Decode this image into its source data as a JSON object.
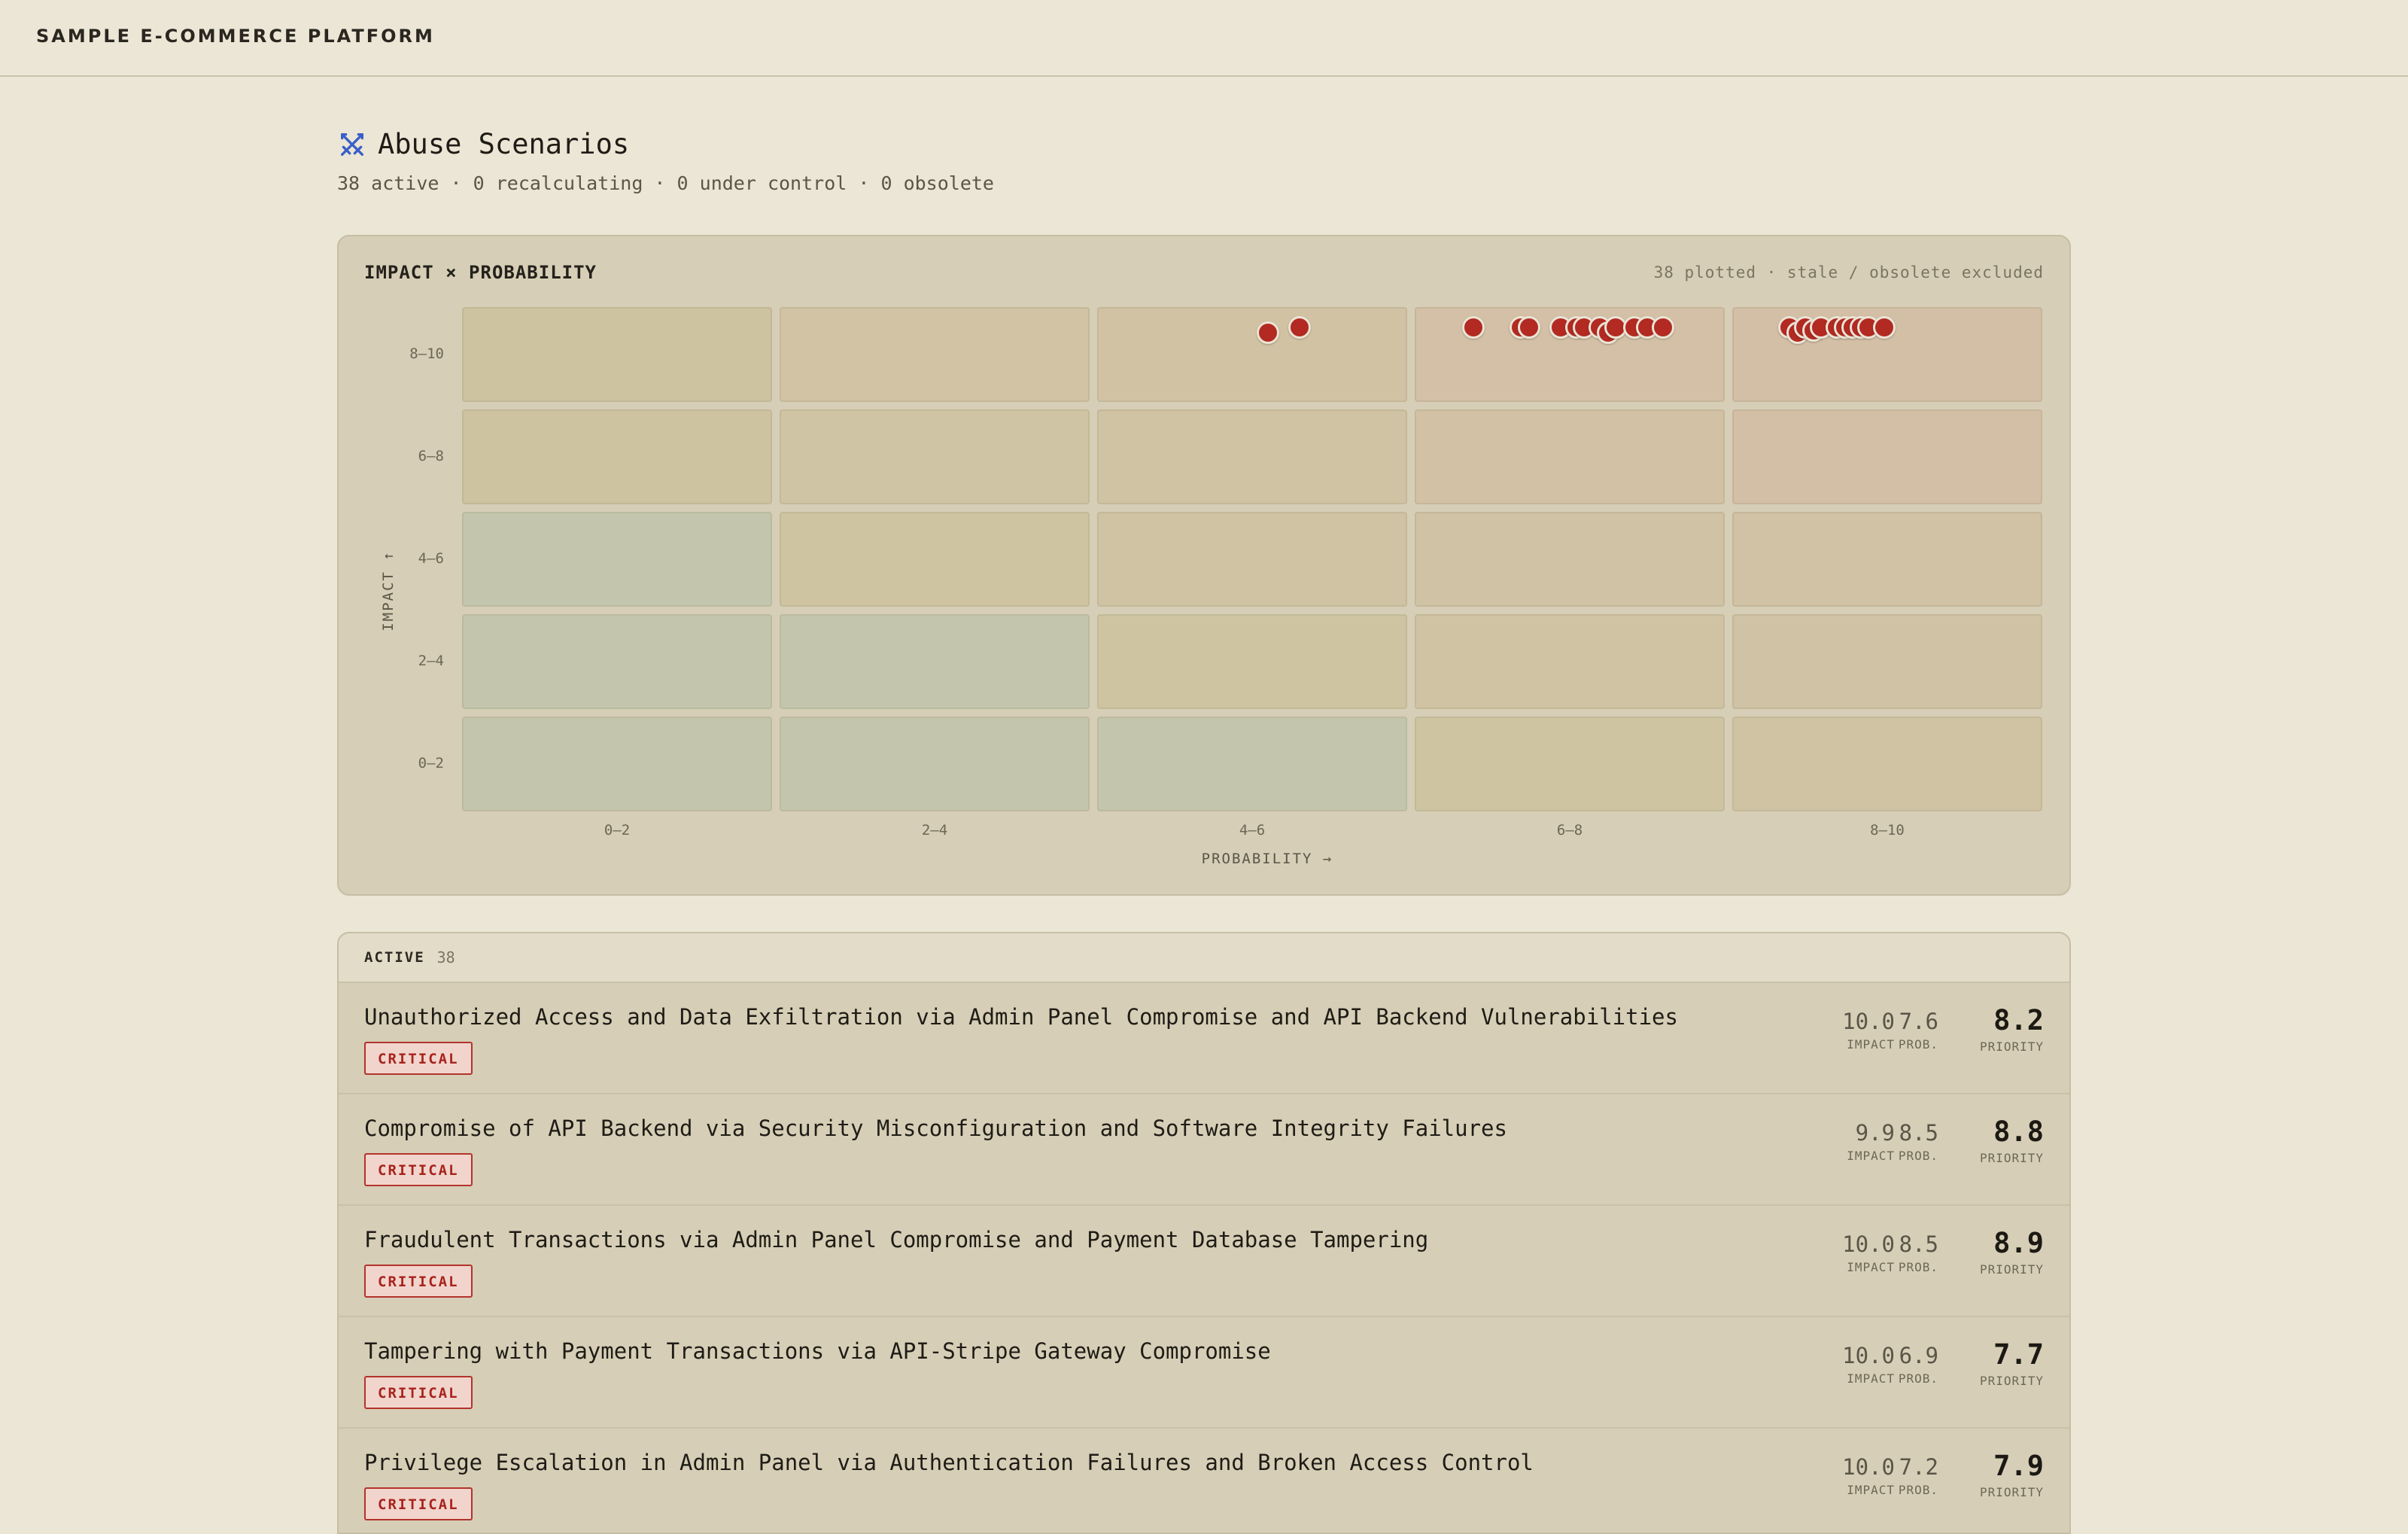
{
  "brand": "SAMPLE E-COMMERCE PLATFORM",
  "page": {
    "title": "Abuse Scenarios",
    "subtitle": "38 active · 0 recalculating · 0 under control · 0 obsolete",
    "icon": "swords-icon"
  },
  "matrix": {
    "title": "IMPACT × PROBABILITY",
    "note": "38 plotted · stale / obsolete excluded",
    "y_axis_title": "IMPACT ↑",
    "x_axis_title": "PROBABILITY →",
    "y_ticks": [
      "8–10",
      "6–8",
      "4–6",
      "2–4",
      "0–2"
    ],
    "x_ticks": [
      "0–2",
      "2–4",
      "4–6",
      "6–8",
      "8–10"
    ],
    "heat_colors": [
      [
        "#cec3a1",
        "#d1c3a4",
        "#d2c2a4",
        "#d3c0a6",
        "#d3bfa6"
      ],
      [
        "#cec3a1",
        "#cfc4a3",
        "#d0c3a4",
        "#d2c1a5",
        "#d3bfa6"
      ],
      [
        "#c3c6ad",
        "#cec4a2",
        "#cfc3a3",
        "#d0c2a4",
        "#d1c1a5"
      ],
      [
        "#c3c6ad",
        "#c3c6ad",
        "#cec4a2",
        "#cfc3a3",
        "#d0c2a4"
      ],
      [
        "#c3c6ad",
        "#c3c6ad",
        "#c3c6ad",
        "#cec4a2",
        "#cfc3a3"
      ]
    ],
    "points": [
      {
        "p": 5.1,
        "i": 9.7
      },
      {
        "p": 5.3,
        "i": 9.8
      },
      {
        "p": 6.4,
        "i": 9.8
      },
      {
        "p": 6.7,
        "i": 9.8
      },
      {
        "p": 6.75,
        "i": 9.8
      },
      {
        "p": 6.95,
        "i": 9.8
      },
      {
        "p": 7.05,
        "i": 9.8
      },
      {
        "p": 7.1,
        "i": 9.8
      },
      {
        "p": 7.2,
        "i": 9.8
      },
      {
        "p": 7.25,
        "i": 9.7
      },
      {
        "p": 7.3,
        "i": 9.8
      },
      {
        "p": 7.42,
        "i": 9.8
      },
      {
        "p": 7.5,
        "i": 9.8
      },
      {
        "p": 7.6,
        "i": 9.8
      },
      {
        "p": 8.4,
        "i": 9.8
      },
      {
        "p": 8.45,
        "i": 9.7
      },
      {
        "p": 8.5,
        "i": 9.8
      },
      {
        "p": 8.55,
        "i": 9.75
      },
      {
        "p": 8.6,
        "i": 9.8
      },
      {
        "p": 8.7,
        "i": 9.8
      },
      {
        "p": 8.75,
        "i": 9.8
      },
      {
        "p": 8.8,
        "i": 9.8
      },
      {
        "p": 8.85,
        "i": 9.8
      },
      {
        "p": 8.9,
        "i": 9.8
      },
      {
        "p": 9.0,
        "i": 9.8
      }
    ]
  },
  "list": {
    "label": "ACTIVE",
    "count": "38",
    "impact_label": "IMPACT",
    "prob_label": "PROB.",
    "priority_label": "PRIORITY",
    "rows": [
      {
        "title": "Unauthorized Access and Data Exfiltration via Admin Panel Compromise and API Backend Vulnerabilities",
        "badge": "CRITICAL",
        "impact": "10.0",
        "prob": "7.6",
        "priority": "8.2"
      },
      {
        "title": "Compromise of API Backend via Security Misconfiguration and Software Integrity Failures",
        "badge": "CRITICAL",
        "impact": "9.9",
        "prob": "8.5",
        "priority": "8.8"
      },
      {
        "title": "Fraudulent Transactions via Admin Panel Compromise and Payment Database Tampering",
        "badge": "CRITICAL",
        "impact": "10.0",
        "prob": "8.5",
        "priority": "8.9"
      },
      {
        "title": "Tampering with Payment Transactions via API-Stripe Gateway Compromise",
        "badge": "CRITICAL",
        "impact": "10.0",
        "prob": "6.9",
        "priority": "7.7"
      },
      {
        "title": "Privilege Escalation in Admin Panel via Authentication Failures and Broken Access Control",
        "badge": "CRITICAL",
        "impact": "10.0",
        "prob": "7.2",
        "priority": "7.9"
      }
    ]
  },
  "colors": {
    "accent_icon": "#3b5fc8",
    "dot": "#b22a22",
    "critical": "#b3332c"
  }
}
